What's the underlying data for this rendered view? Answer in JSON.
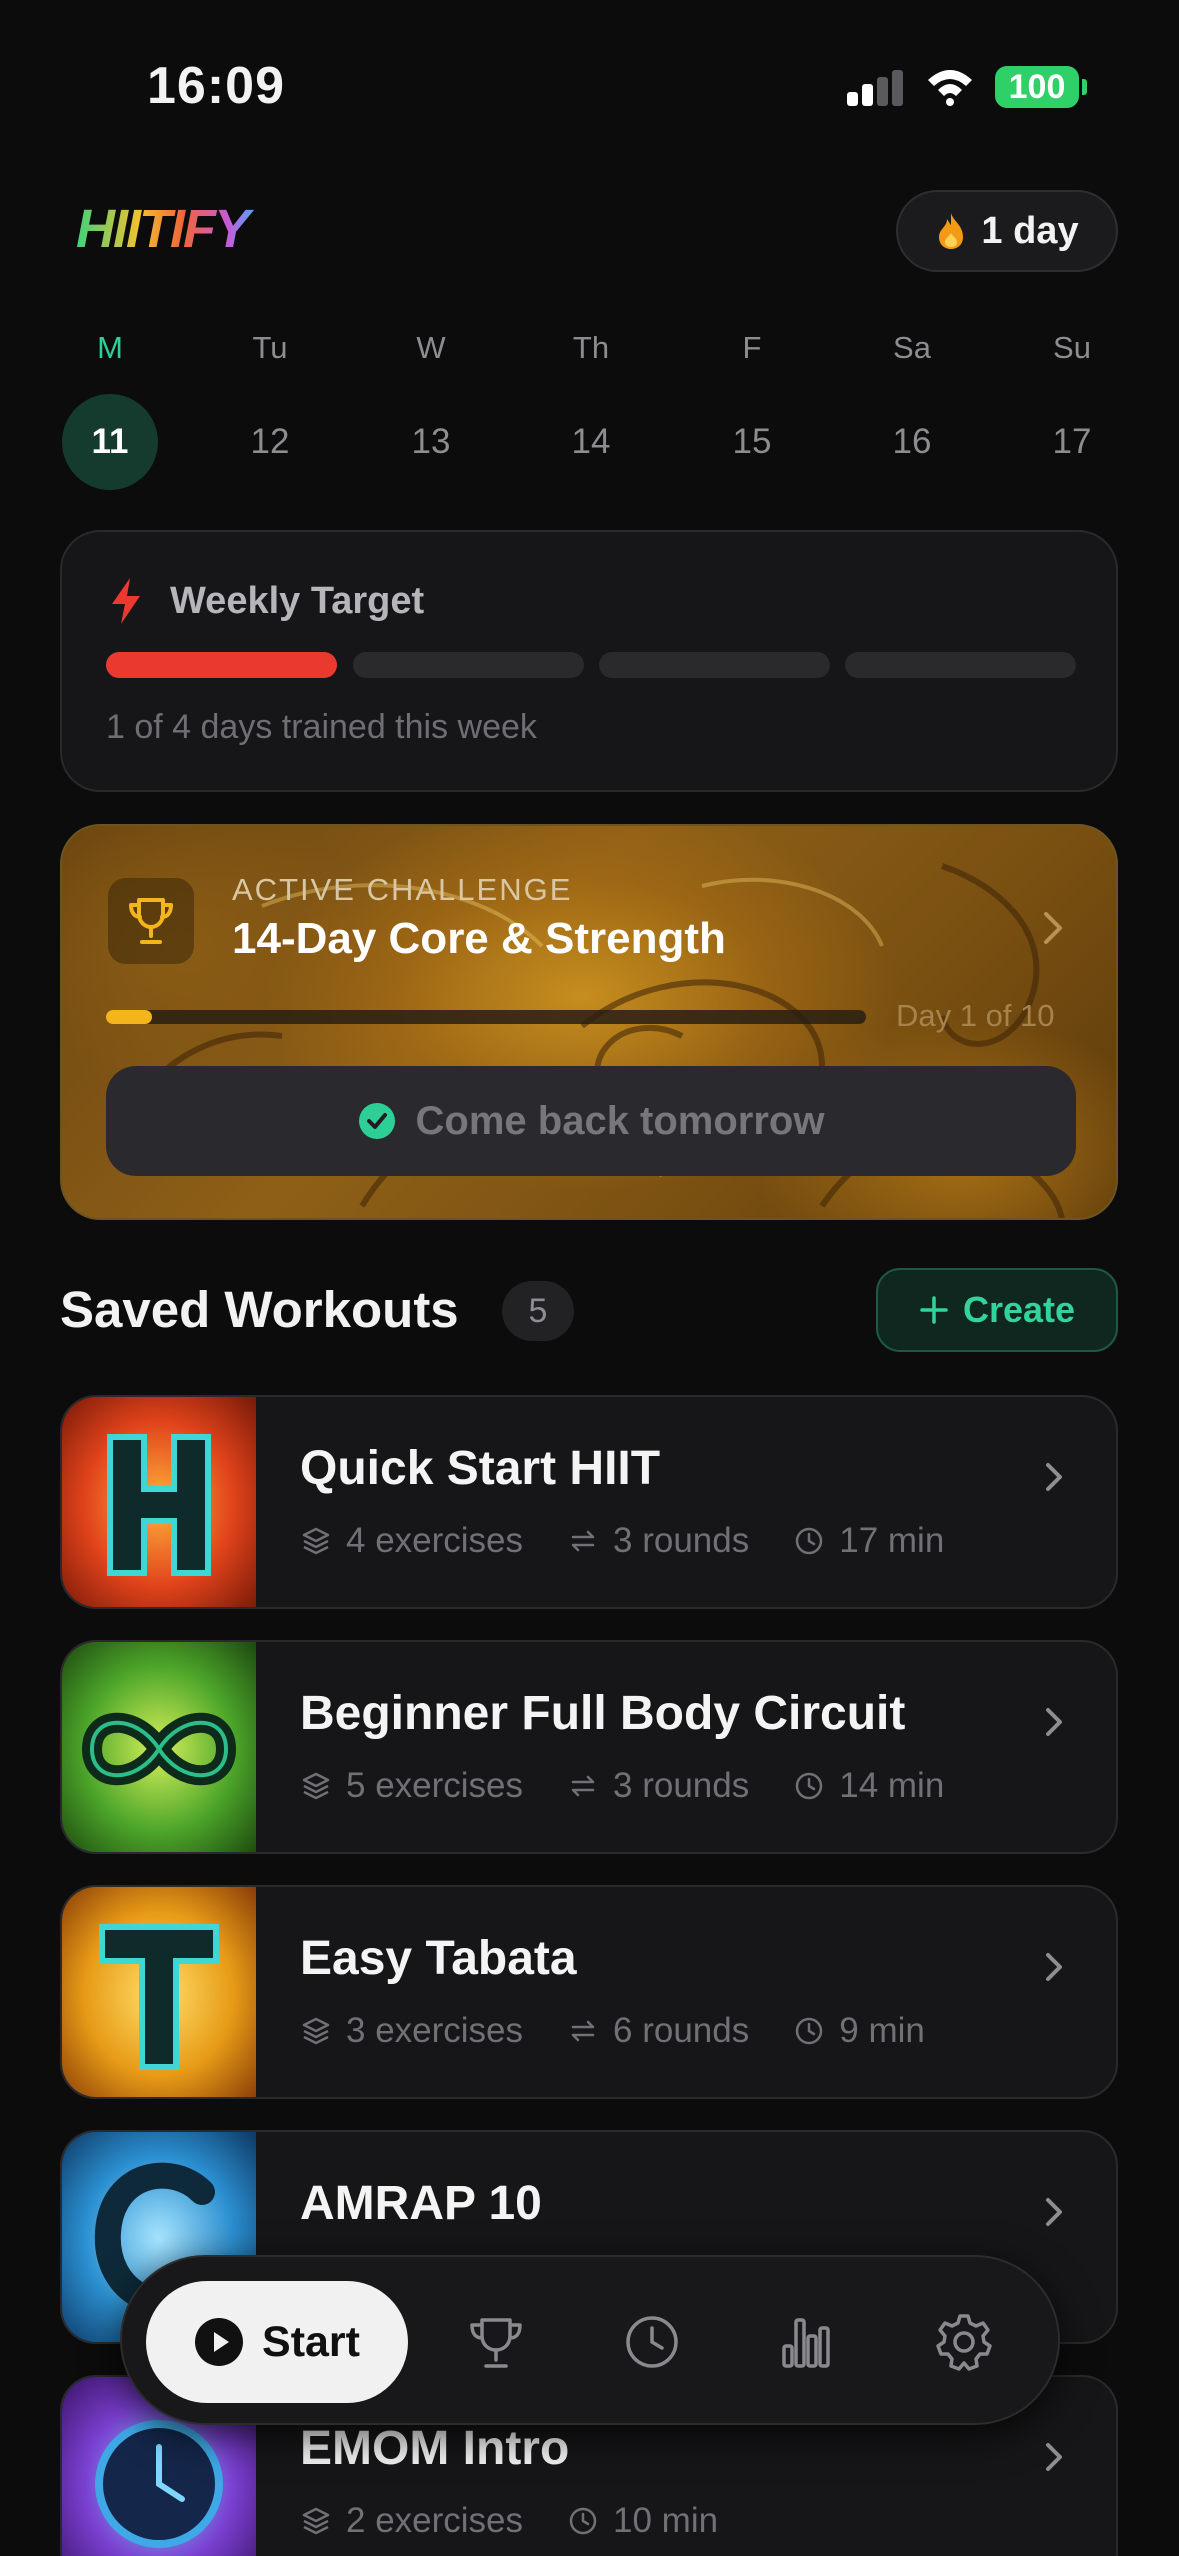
{
  "status_bar": {
    "time": "16:09",
    "battery": "100"
  },
  "header": {
    "logo_text": "HIITIFY",
    "streak_label": "1 day"
  },
  "week": [
    {
      "day": "M",
      "date": "11",
      "active": true
    },
    {
      "day": "Tu",
      "date": "12"
    },
    {
      "day": "W",
      "date": "13"
    },
    {
      "day": "Th",
      "date": "14"
    },
    {
      "day": "F",
      "date": "15"
    },
    {
      "day": "Sa",
      "date": "16"
    },
    {
      "day": "Su",
      "date": "17"
    }
  ],
  "weekly_target": {
    "title": "Weekly Target",
    "completed_days": 1,
    "total_days": 4,
    "subtitle": "1 of 4 days trained this week"
  },
  "challenge": {
    "eyebrow": "ACTIVE CHALLENGE",
    "name": "14-Day Core & Strength",
    "progress": 0.06,
    "day_label": "Day 1 of 10",
    "button_label": "Come back tomorrow"
  },
  "saved": {
    "title": "Saved Workouts",
    "count": "5",
    "create_label": "Create"
  },
  "workouts": [
    {
      "name": "Quick Start HIIT",
      "exercises": "4 exercises",
      "rounds": "3 rounds",
      "duration": "17 min",
      "thumb": "flame-H-icon"
    },
    {
      "name": "Beginner Full Body Circuit",
      "exercises": "5 exercises",
      "rounds": "3 rounds",
      "duration": "14 min",
      "thumb": "infinity-icon"
    },
    {
      "name": "Easy Tabata",
      "exercises": "3 exercises",
      "rounds": "6 rounds",
      "duration": "9 min",
      "thumb": "fire-T-icon"
    },
    {
      "name": "AMRAP 10",
      "thumb": "water-swirl-icon"
    },
    {
      "name": "EMOM Intro",
      "exercises": "2 exercises",
      "duration": "10 min",
      "thumb": "clock-icon"
    }
  ],
  "nav": {
    "start_label": "Start"
  },
  "colors": {
    "accent_green": "#2ecf97",
    "target_red": "#ea3a30",
    "challenge_gold": "#f4b51c",
    "background": "#0c0c0d"
  }
}
